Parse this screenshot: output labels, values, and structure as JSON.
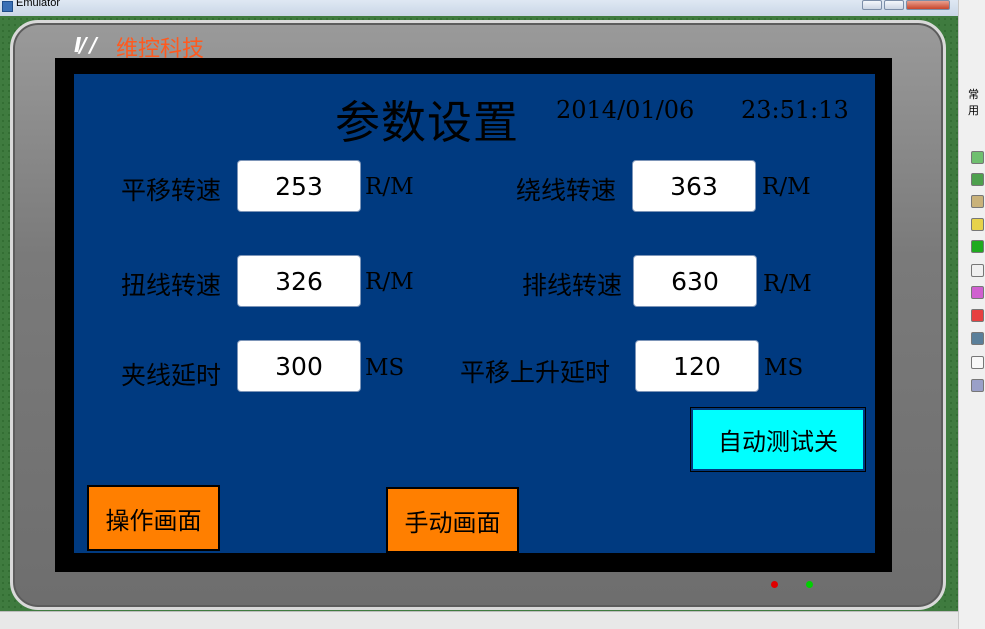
{
  "window": {
    "title": "Emulator"
  },
  "brand": {
    "text": "维控科技"
  },
  "hmi": {
    "title": "参数设置",
    "date": "2014/01/06",
    "time": "23:51:13",
    "params": [
      {
        "label": "平移转速",
        "value": "253",
        "unit": "R/M"
      },
      {
        "label": "绕线转速",
        "value": "363",
        "unit": "R/M"
      },
      {
        "label": "扭线转速",
        "value": "326",
        "unit": "R/M"
      },
      {
        "label": "排线转速",
        "value": "630",
        "unit": "R/M"
      },
      {
        "label": "夹线延时",
        "value": "300",
        "unit": "MS"
      },
      {
        "label": "平移上升延时",
        "value": "120",
        "unit": "MS"
      }
    ],
    "buttons": {
      "auto_test": "自动测试关",
      "operation": "操作画面",
      "manual": "手动画面"
    }
  },
  "palette": {
    "title": "常用"
  },
  "leds": {
    "red": "#e00000",
    "green": "#00d000"
  },
  "colors": {
    "screen": "#003a80",
    "orange_button": "#ff7f00",
    "cyan_button": "#00ffff",
    "brand_text": "#ff5a1f"
  }
}
